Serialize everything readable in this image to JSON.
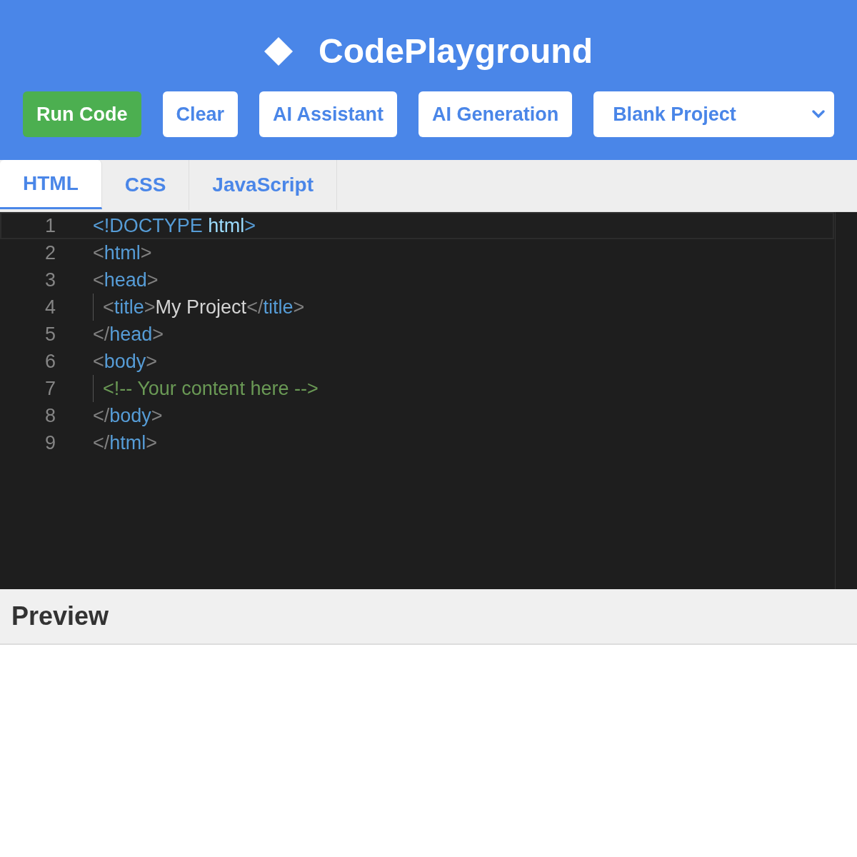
{
  "header": {
    "title": "CodePlayground"
  },
  "toolbar": {
    "buttons": [
      {
        "label": "Run Code",
        "kind": "primary"
      },
      {
        "label": "Clear",
        "kind": "default"
      },
      {
        "label": "AI Assistant",
        "kind": "default"
      },
      {
        "label": "AI Generation",
        "kind": "default"
      }
    ],
    "template_select": {
      "value": "Blank Project"
    }
  },
  "tabs": [
    {
      "label": "HTML",
      "selected": true
    },
    {
      "label": "CSS",
      "selected": false
    },
    {
      "label": "JavaScript",
      "selected": false
    }
  ],
  "editor": {
    "lines": [
      {
        "number": "1",
        "active": true,
        "indented": false,
        "tokens": [
          {
            "kind": "doctype",
            "text": "<!DOCTYPE"
          },
          {
            "kind": "attr",
            "text": " html"
          },
          {
            "kind": "doctype",
            "text": ">"
          }
        ]
      },
      {
        "number": "2",
        "active": false,
        "indented": false,
        "tokens": [
          {
            "kind": "punct",
            "text": "<"
          },
          {
            "kind": "tag",
            "text": "html"
          },
          {
            "kind": "punct",
            "text": ">"
          }
        ]
      },
      {
        "number": "3",
        "active": false,
        "indented": false,
        "tokens": [
          {
            "kind": "punct",
            "text": "<"
          },
          {
            "kind": "tag",
            "text": "head"
          },
          {
            "kind": "punct",
            "text": ">"
          }
        ]
      },
      {
        "number": "4",
        "active": false,
        "indented": true,
        "tokens": [
          {
            "kind": "punct",
            "text": "<"
          },
          {
            "kind": "tag",
            "text": "title"
          },
          {
            "kind": "punct",
            "text": ">"
          },
          {
            "kind": "text",
            "text": "My Project"
          },
          {
            "kind": "punct",
            "text": "</"
          },
          {
            "kind": "tag",
            "text": "title"
          },
          {
            "kind": "punct",
            "text": ">"
          }
        ]
      },
      {
        "number": "5",
        "active": false,
        "indented": false,
        "tokens": [
          {
            "kind": "punct",
            "text": "</"
          },
          {
            "kind": "tag",
            "text": "head"
          },
          {
            "kind": "punct",
            "text": ">"
          }
        ]
      },
      {
        "number": "6",
        "active": false,
        "indented": false,
        "tokens": [
          {
            "kind": "punct",
            "text": "<"
          },
          {
            "kind": "tag",
            "text": "body"
          },
          {
            "kind": "punct",
            "text": ">"
          }
        ]
      },
      {
        "number": "7",
        "active": false,
        "indented": true,
        "tokens": [
          {
            "kind": "comment",
            "text": "<!-- Your content here -->"
          }
        ]
      },
      {
        "number": "8",
        "active": false,
        "indented": false,
        "tokens": [
          {
            "kind": "punct",
            "text": "</"
          },
          {
            "kind": "tag",
            "text": "body"
          },
          {
            "kind": "punct",
            "text": ">"
          }
        ]
      },
      {
        "number": "9",
        "active": false,
        "indented": false,
        "tokens": [
          {
            "kind": "punct",
            "text": "</"
          },
          {
            "kind": "tag",
            "text": "html"
          },
          {
            "kind": "punct",
            "text": ">"
          }
        ]
      }
    ]
  },
  "preview": {
    "title": "Preview"
  }
}
